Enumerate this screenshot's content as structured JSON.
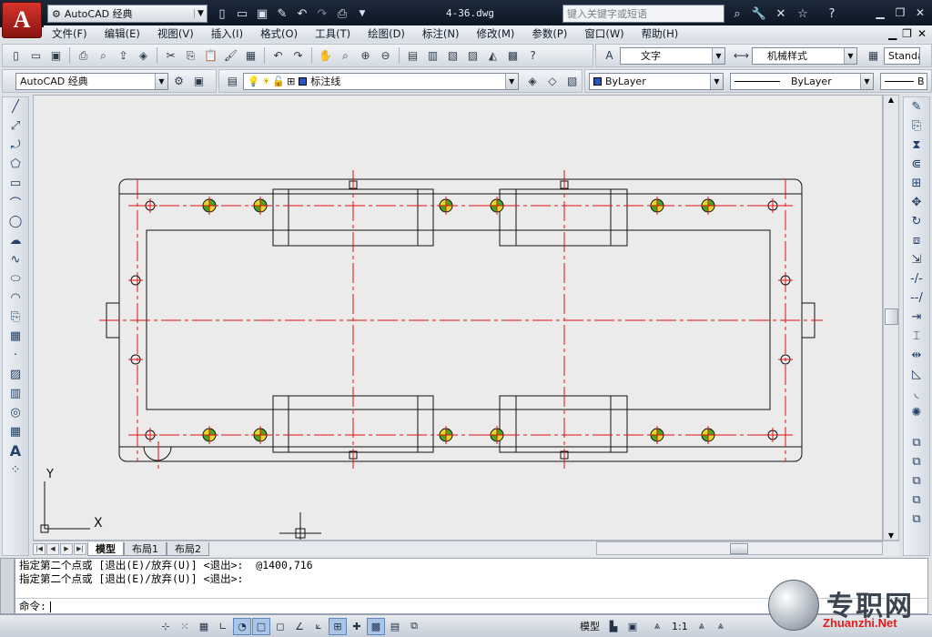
{
  "window": {
    "workspace": "AutoCAD 经典",
    "file_name": "4-36.dwg",
    "search_placeholder": "键入关键字或短语"
  },
  "menu": [
    "文件(F)",
    "编辑(E)",
    "视图(V)",
    "插入(I)",
    "格式(O)",
    "工具(T)",
    "绘图(D)",
    "标注(N)",
    "修改(M)",
    "参数(P)",
    "窗口(W)",
    "帮助(H)"
  ],
  "toolbars": {
    "text_style": "文字",
    "table_style": "机械样式",
    "dim_style": "Standa",
    "workspace_combo": "AutoCAD 经典",
    "layer": "标注线",
    "color": "ByLayer",
    "linetype": "ByLayer",
    "lineweight": "B"
  },
  "tabs": [
    "模型",
    "布局1",
    "布局2"
  ],
  "command": {
    "history": [
      "指定第二个点或 [退出(E)/放弃(U)] <退出>:  @1400,716",
      "指定第二个点或 [退出(E)/放弃(U)] <退出>:"
    ],
    "prompt": "命令:"
  },
  "status": {
    "model_label": "模型",
    "scale": "1:1"
  },
  "ucs": {
    "x": "X",
    "y": "Y"
  },
  "watermark": {
    "cn": "专职网",
    "en": "Zhuanzhi.Net"
  },
  "colors": {
    "centerline": "#e01010",
    "geometry": "#111111",
    "hatch_green": "#4aa51c",
    "hatch_yellow": "#e3d62c"
  }
}
